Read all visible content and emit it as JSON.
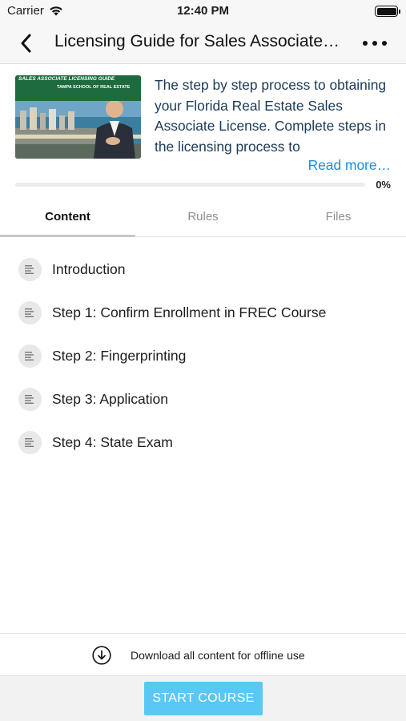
{
  "status_bar": {
    "carrier": "Carrier",
    "time": "12:40 PM",
    "icons": [
      "wifi-icon",
      "battery-icon"
    ]
  },
  "nav": {
    "title": "Licensing Guide for Sales Associate Licensing Guide",
    "back_icon": "chevron-left-icon",
    "more_icon": "more-horizontal-icon"
  },
  "course": {
    "thumbnail_banner": "SALES ASSOCIATE LICENSING GUIDE",
    "thumbnail_logo": "TAMPA SCHOOL OF REAL ESTATE",
    "description": "The step by step process to obtaining your Florida Real Estate Sales Associate License. Complete steps in the licensing process to",
    "read_more": "Read more…",
    "progress_percent": 0,
    "progress_label": "0%"
  },
  "tabs": [
    {
      "label": "Content",
      "active": true
    },
    {
      "label": "Rules",
      "active": false
    },
    {
      "label": "Files",
      "active": false
    }
  ],
  "lessons": [
    {
      "label": "Introduction",
      "icon": "text-lines-icon"
    },
    {
      "label": "Step 1: Confirm Enrollment in FREC Course",
      "icon": "text-lines-icon"
    },
    {
      "label": "Step 2: Fingerprinting",
      "icon": "text-lines-icon"
    },
    {
      "label": "Step 3: Application",
      "icon": "text-lines-icon"
    },
    {
      "label": "Step 4: State Exam",
      "icon": "text-lines-icon"
    }
  ],
  "download": {
    "label": "Download all content for offline use",
    "icon": "download-circle-icon"
  },
  "actions": {
    "start_course": "START COURSE"
  },
  "colors": {
    "accent": "#1a8fdc",
    "start_button": "#5ac8f5",
    "description_text": "#1b3a57"
  }
}
